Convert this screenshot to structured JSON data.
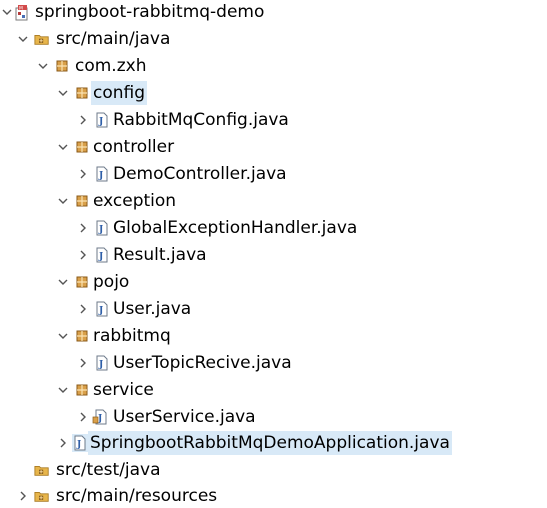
{
  "colors": {
    "selection_background": "#d8e9f7",
    "package_icon": "#b07a2a",
    "java_file_icon": "#2f5fa8",
    "source_folder_icon": "#c9962e",
    "project_icon": "#b53a3a"
  },
  "tree": {
    "project": {
      "label": "springboot-rabbitmq-demo",
      "icon": "maven-project-icon",
      "expanded": true
    },
    "src_main_java": {
      "label": "src/main/java",
      "icon": "source-folder-icon",
      "expanded": true
    },
    "pkg_com_zxh": {
      "label": "com.zxh",
      "icon": "package-icon",
      "expanded": true
    },
    "pkg_config": {
      "label": "config",
      "icon": "package-icon",
      "expanded": true,
      "selected": true
    },
    "file_rabbitmqconfig": {
      "label": "RabbitMqConfig.java",
      "icon": "java-file-icon",
      "expanded": false
    },
    "pkg_controller": {
      "label": "controller",
      "icon": "package-icon",
      "expanded": true
    },
    "file_democontroller": {
      "label": "DemoController.java",
      "icon": "java-file-icon",
      "expanded": false
    },
    "pkg_exception": {
      "label": "exception",
      "icon": "package-icon",
      "expanded": true
    },
    "file_globalexceptionhandler": {
      "label": "GlobalExceptionHandler.java",
      "icon": "java-file-icon",
      "expanded": false
    },
    "file_result": {
      "label": "Result.java",
      "icon": "java-file-icon",
      "expanded": false
    },
    "pkg_pojo": {
      "label": "pojo",
      "icon": "package-icon",
      "expanded": true
    },
    "file_user": {
      "label": "User.java",
      "icon": "java-file-icon",
      "expanded": false
    },
    "pkg_rabbitmq": {
      "label": "rabbitmq",
      "icon": "package-icon",
      "expanded": true
    },
    "file_usertopicrecive": {
      "label": "UserTopicRecive.java",
      "icon": "java-file-icon",
      "expanded": false
    },
    "pkg_service": {
      "label": "service",
      "icon": "package-icon",
      "expanded": true
    },
    "file_userservice": {
      "label": "UserService.java",
      "icon": "java-interface-file-icon",
      "expanded": false
    },
    "file_application": {
      "label": "SpringbootRabbitMqDemoApplication.java",
      "icon": "java-file-icon",
      "expanded": false,
      "selected": true
    },
    "src_test_java": {
      "label": "src/test/java",
      "icon": "source-folder-icon"
    },
    "src_main_resources": {
      "label": "src/main/resources",
      "icon": "source-folder-icon",
      "expanded": false
    }
  }
}
